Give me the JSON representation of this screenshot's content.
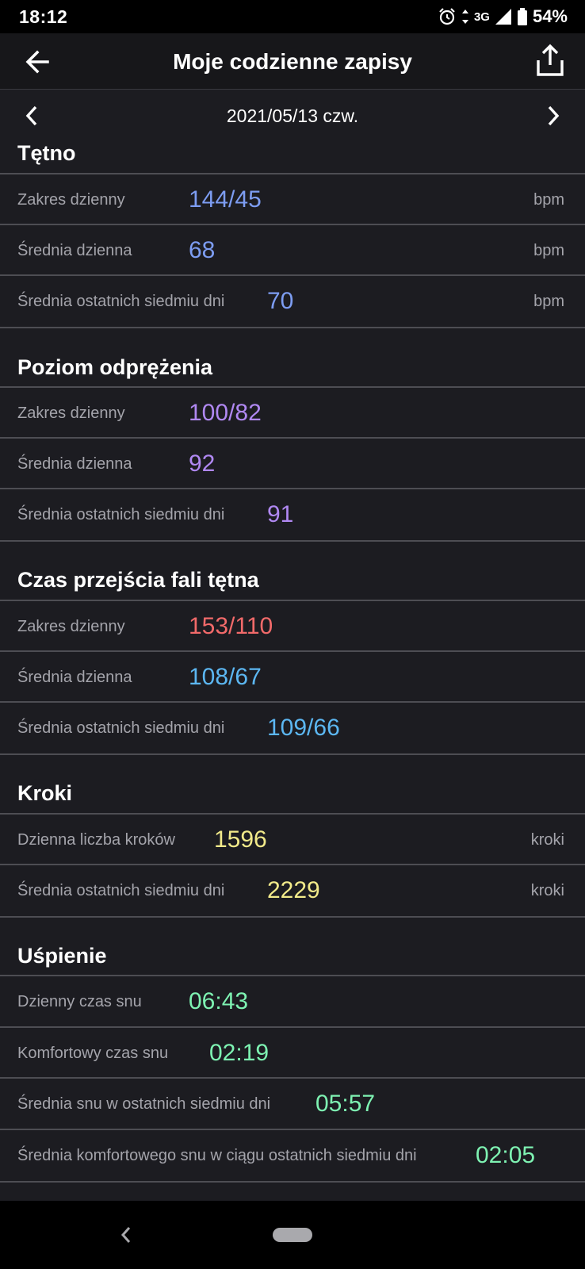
{
  "status": {
    "time": "18:12",
    "network": "3G",
    "battery": "54%"
  },
  "header": {
    "title": "Moje codzienne zapisy",
    "icons": [
      "back-arrow-icon",
      "share-icon"
    ]
  },
  "date": "2021/05/13 czw.",
  "colors": {
    "heart": "#7d9df2",
    "relax": "#b088f2",
    "pulse_high": "#f26a6a",
    "pulse": "#5cb7f2",
    "steps": "#f2ea8a",
    "sleep": "#7ef2b2"
  },
  "sections": [
    {
      "title": "Tętno",
      "rows": [
        {
          "label": "Zakres dzienny",
          "value": "144/45",
          "unit": "bpm"
        },
        {
          "label": "Średnia dzienna",
          "value": "68",
          "unit": "bpm"
        },
        {
          "label": "Średnia ostatnich siedmiu dni",
          "value": "70",
          "unit": "bpm"
        }
      ]
    },
    {
      "title": "Poziom odprężenia",
      "rows": [
        {
          "label": "Zakres dzienny",
          "value": "100/82"
        },
        {
          "label": "Średnia dzienna",
          "value": "92"
        },
        {
          "label": "Średnia ostatnich siedmiu dni",
          "value": "91"
        }
      ]
    },
    {
      "title": "Czas przejścia fali tętna",
      "rows": [
        {
          "label": "Zakres dzienny",
          "value": "153/110"
        },
        {
          "label": "Średnia dzienna",
          "value": "108/67"
        },
        {
          "label": "Średnia ostatnich siedmiu dni",
          "value": "109/66"
        }
      ]
    },
    {
      "title": "Kroki",
      "rows": [
        {
          "label": "Dzienna liczba kroków",
          "value": "1596",
          "unit": "kroki"
        },
        {
          "label": "Średnia ostatnich siedmiu dni",
          "value": "2229",
          "unit": "kroki"
        }
      ]
    },
    {
      "title": "Uśpienie",
      "rows": [
        {
          "label": "Dzienny czas snu",
          "value": "06:43"
        },
        {
          "label": "Komfortowy czas snu",
          "value": "02:19"
        },
        {
          "label": "Średnia snu w ostatnich siedmiu dni",
          "value": "05:57"
        },
        {
          "label": "Średnia komfortowego snu w ciągu ostatnich siedmiu dni",
          "value": "02:05"
        }
      ]
    }
  ]
}
